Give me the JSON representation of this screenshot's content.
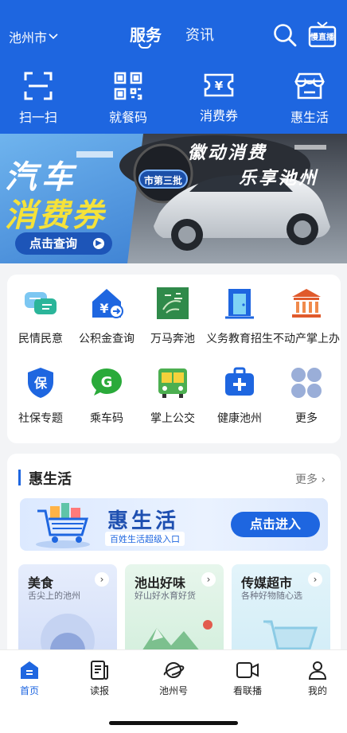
{
  "header": {
    "city": "池州市",
    "tabs": [
      {
        "label": "服务",
        "active": true
      },
      {
        "label": "资讯",
        "active": false
      }
    ],
    "live_label": "慢直播"
  },
  "quick_actions": [
    {
      "label": "扫一扫",
      "icon": "scan-icon"
    },
    {
      "label": "就餐码",
      "icon": "qr-code-icon"
    },
    {
      "label": "消费券",
      "icon": "coupon-icon"
    },
    {
      "label": "惠生活",
      "icon": "shop-icon"
    }
  ],
  "banner": {
    "line1": "汽车",
    "line2": "消费券",
    "badge": "市第三批",
    "slogan1": "徽动消费",
    "slogan2": "乐享池州",
    "button": "点击查询"
  },
  "services": [
    {
      "label": "民情民意",
      "icon": "chat-bubbles-icon"
    },
    {
      "label": "公积金查询",
      "icon": "housing-fund-icon"
    },
    {
      "label": "万马奔池",
      "icon": "horse-logo-icon"
    },
    {
      "label": "义务教育招生",
      "icon": "school-door-icon"
    },
    {
      "label": "不动产掌上办",
      "icon": "bank-building-icon"
    },
    {
      "label": "社保专题",
      "icon": "shield-icon"
    },
    {
      "label": "乘车码",
      "icon": "ride-code-icon"
    },
    {
      "label": "掌上公交",
      "icon": "bus-icon"
    },
    {
      "label": "健康池州",
      "icon": "medical-kit-icon"
    },
    {
      "label": "更多",
      "icon": "more-grid-icon"
    }
  ],
  "section": {
    "title": "惠生活",
    "more": "更多"
  },
  "promo": {
    "title": "惠生活",
    "subtitle": "百姓生活超级入口",
    "button": "点击进入"
  },
  "cards": [
    {
      "title": "美食",
      "subtitle": "舌尖上的池州"
    },
    {
      "title": "池出好味",
      "subtitle": "好山好水育好货"
    },
    {
      "title": "传媒超市",
      "subtitle": "各种好物随心选"
    }
  ],
  "bottom_nav": [
    {
      "label": "首页",
      "icon": "home-icon",
      "active": true
    },
    {
      "label": "读报",
      "icon": "newspaper-icon",
      "active": false
    },
    {
      "label": "池州号",
      "icon": "planet-icon",
      "active": false
    },
    {
      "label": "看联播",
      "icon": "video-icon",
      "active": false
    },
    {
      "label": "我的",
      "icon": "user-icon",
      "active": false
    }
  ],
  "colors": {
    "brand": "#1e66e0",
    "banner_yellow": "#f5e23a",
    "more_gray": "#9aaed8"
  }
}
